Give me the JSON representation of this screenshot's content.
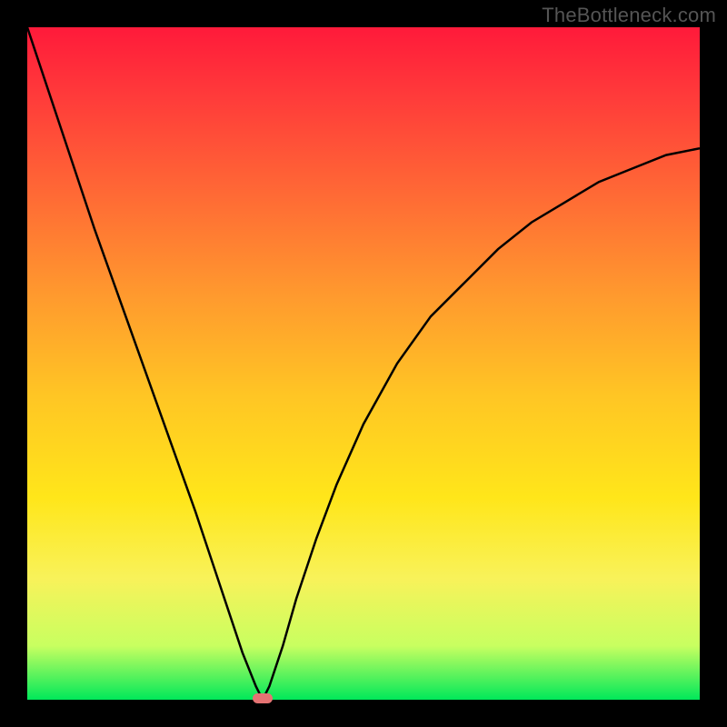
{
  "watermark": "TheBottleneck.com",
  "chart_data": {
    "type": "line",
    "title": "",
    "xlabel": "",
    "ylabel": "",
    "xlim": [
      0,
      100
    ],
    "ylim": [
      0,
      100
    ],
    "grid": false,
    "legend": false,
    "series": [
      {
        "name": "curve",
        "x": [
          0,
          5,
          10,
          15,
          20,
          25,
          28,
          30,
          32,
          34,
          35,
          36,
          38,
          40,
          43,
          46,
          50,
          55,
          60,
          65,
          70,
          75,
          80,
          85,
          90,
          95,
          100
        ],
        "values": [
          100,
          85,
          70,
          56,
          42,
          28,
          19,
          13,
          7,
          2,
          0,
          2,
          8,
          15,
          24,
          32,
          41,
          50,
          57,
          62,
          67,
          71,
          74,
          77,
          79,
          81,
          82
        ]
      }
    ],
    "marker": {
      "x": 35,
      "y": 0
    },
    "background": "red-yellow-green vertical gradient"
  }
}
